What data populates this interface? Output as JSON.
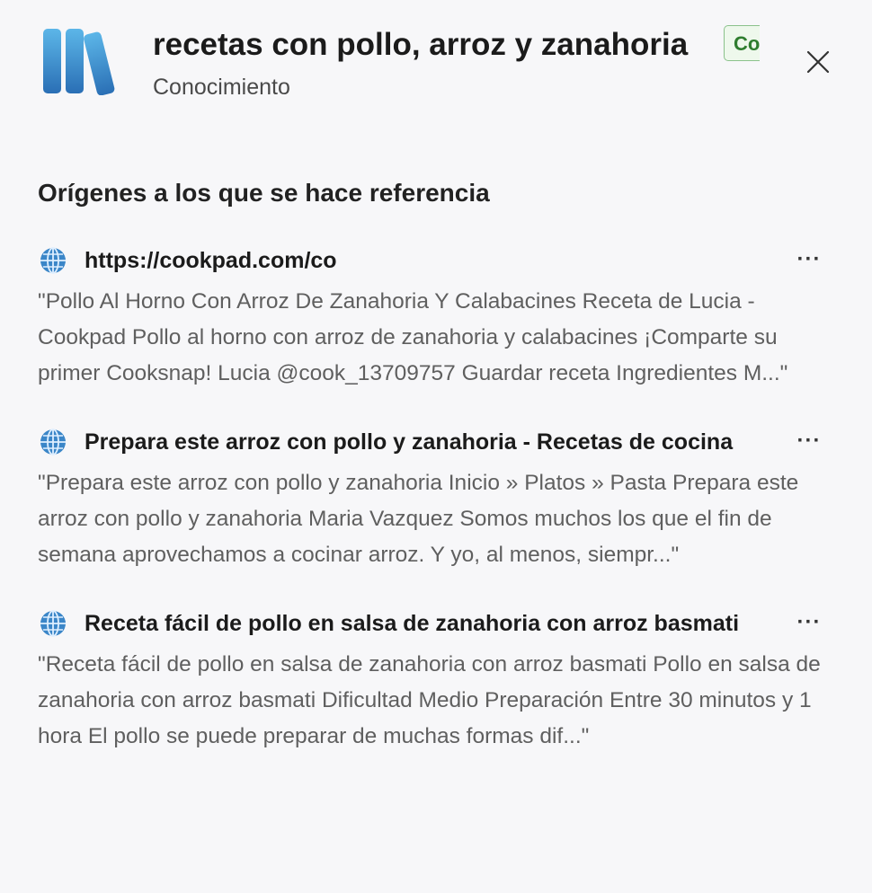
{
  "header": {
    "title": "recetas con pollo, arroz y zanahoria",
    "subtitle": "Conocimiento",
    "badge": "Co",
    "icon": "books-icon",
    "close_icon": "close-icon"
  },
  "section": {
    "title": "Orígenes a los que se hace referencia"
  },
  "references": [
    {
      "title": "https://cookpad.com/co",
      "snippet": "\"Pollo Al Horno Con Arroz De Zanahoria Y Calabacines Receta de Lucia - Cookpad Pollo al horno con arroz de zanahoria y calabacines ¡Comparte su primer Cooksnap! Lucia @cook_13709757 Guardar receta Ingredientes M...\"",
      "more": "···"
    },
    {
      "title": "Prepara este arroz con pollo y zanahoria - Recetas de cocina",
      "snippet": "\"Prepara este arroz con pollo y zanahoria Inicio » Platos » Pasta Prepara este arroz con pollo y zanahoria Maria Vazquez Somos muchos los que el fin de semana aprovechamos a cocinar arroz. Y yo, al menos, siempr...\"",
      "more": "···"
    },
    {
      "title": "Receta fácil de pollo en salsa de zanahoria con arroz basmati",
      "snippet": "\"Receta fácil de pollo en salsa de zanahoria con arroz basmati Pollo en salsa de zanahoria con arroz basmati Dificultad Medio Preparación Entre 30 minutos y 1 hora El pollo se puede preparar de muchas formas dif...\"",
      "more": "···"
    }
  ],
  "colors": {
    "accent_blue": "#2f7fc1",
    "badge_green": "#2f7d2f",
    "background": "#f7f7f9"
  }
}
